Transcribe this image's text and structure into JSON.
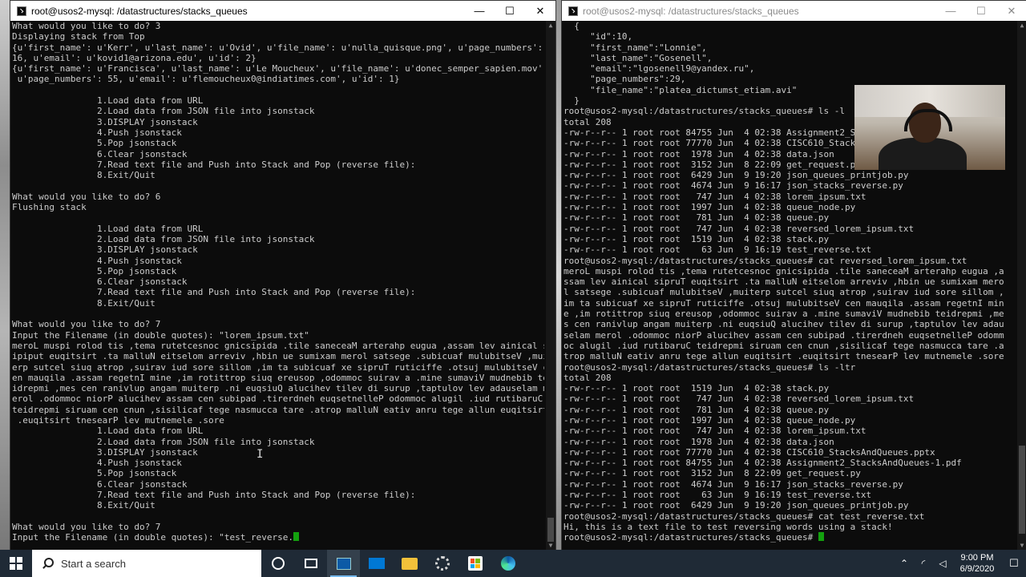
{
  "left_window": {
    "title": "root@usos2-mysql: /datastructures/stacks_queues",
    "controls": [
      "—",
      "☐",
      "✕"
    ],
    "lines": [
      "What would you like to do? 3",
      "Displaying stack from Top",
      "{u'first_name': u'Kerr', u'last_name': u'Ovid', u'file_name': u'nulla_quisque.png', u'page_numbers':",
      "16, u'email': u'kovid1@arizona.edu', u'id': 2}",
      "{u'first_name': u'Francisca', u'last_name': u'Le Moucheux', u'file_name': u'donec_semper_sapien.mov',",
      " u'page_numbers': 55, u'email': u'flemoucheux0@indiatimes.com', u'id': 1}",
      "",
      "                1.Load data from URL",
      "                2.Load data from JSON file into jsonstack",
      "                3.DISPLAY jsonstack",
      "                4.Push jsonstack",
      "                5.Pop jsonstack",
      "                6.Clear jsonstack",
      "                7.Read text file and Push into Stack and Pop (reverse file):",
      "                8.Exit/Quit",
      "",
      "What would you like to do? 6",
      "Flushing stack",
      "",
      "                1.Load data from URL",
      "                2.Load data from JSON file into jsonstack",
      "                3.DISPLAY jsonstack",
      "                4.Push jsonstack",
      "                5.Pop jsonstack",
      "                6.Clear jsonstack",
      "                7.Read text file and Push into Stack and Pop (reverse file):",
      "                8.Exit/Quit",
      "",
      "What would you like to do? 7",
      "Input the Filename (in double quotes): \"lorem_ipsum.txt\"",
      "meroL muspi rolod tis ,tema rutetcesnoc gnicsipida .tile saneceaM arterahp eugua ,assam lev ainical s",
      "ipiput euqitsirt .ta malluN eitselom arreviv ,hbin ue sumixam merol satsege .subicuaf mulubitseV ,muit",
      "erp sutcel siuq atrop ,suirav iud sore sillom ,im ta subicuaf xe sipruT ruticiffe .otsuj mulubitseV c",
      "en mauqila .assam regetnI mine ,im rotittrop siuq ereusop ,odommoc suirav a .mine sumaviV mudnebib te",
      "idrepmi ,mes cen ranivlup angam muiterp .ni euqsiuQ alucihev tilev di surup ,taptulov lev adauselam m",
      "erol .odommoc niorP alucihev assam cen subipad .tirerdneh euqsetnelleP odommoc alugil .iud rutibaruC",
      "teidrepmi siruam cen cnun ,sisilicaf tege nasmucca tare .atrop malluN eativ anru tege allun euqitsirt",
      " .euqitsirt tnesearP lev mutnemele .sore",
      "                1.Load data from URL",
      "                2.Load data from JSON file into jsonstack",
      "                3.DISPLAY jsonstack",
      "                4.Push jsonstack",
      "                5.Pop jsonstack",
      "                6.Clear jsonstack",
      "                7.Read text file and Push into Stack and Pop (reverse file):",
      "                8.Exit/Quit",
      "",
      "What would you like to do? 7"
    ],
    "prompt_line": "Input the Filename (in double quotes): \"test_reverse."
  },
  "right_window": {
    "title": "root@usos2-mysql: /datastructures/stacks_queues",
    "controls": [
      "—",
      "☐",
      "✕"
    ],
    "lines": [
      "  {",
      "     \"id\":10,",
      "     \"first_name\":\"Lonnie\",",
      "     \"last_name\":\"Gosenell\",",
      "     \"email\":\"lgosenell9@yandex.ru\",",
      "     \"page_numbers\":29,",
      "     \"file_name\":\"platea_dictumst_etiam.avi\"",
      "  }",
      "root@usos2-mysql:/datastructures/stacks_queues# ls -l",
      "total 208",
      "-rw-r--r-- 1 root root 84755 Jun  4 02:38 Assignment2_S",
      "-rw-r--r-- 1 root root 77770 Jun  4 02:38 CISC610_Stack",
      "-rw-r--r-- 1 root root  1978 Jun  4 02:38 data.json",
      "-rw-r--r-- 1 root root  3152 Jun  8 22:09 get_request.p",
      "-rw-r--r-- 1 root root  6429 Jun  9 19:20 json_queues_printjob.py",
      "-rw-r--r-- 1 root root  4674 Jun  9 16:17 json_stacks_reverse.py",
      "-rw-r--r-- 1 root root   747 Jun  4 02:38 lorem_ipsum.txt",
      "-rw-r--r-- 1 root root  1997 Jun  4 02:38 queue_node.py",
      "-rw-r--r-- 1 root root   781 Jun  4 02:38 queue.py",
      "-rw-r--r-- 1 root root   747 Jun  4 02:38 reversed_lorem_ipsum.txt",
      "-rw-r--r-- 1 root root  1519 Jun  4 02:38 stack.py",
      "-rw-r--r-- 1 root root    63 Jun  9 16:19 test_reverse.txt",
      "root@usos2-mysql:/datastructures/stacks_queues# cat reversed_lorem_ipsum.txt",
      "meroL muspi rolod tis ,tema rutetcesnoc gnicsipida .tile saneceaM arterahp eugua ,a",
      "ssam lev ainical sipruT euqitsirt .ta malluN eitselom arreviv ,hbin ue sumixam mero",
      "l satsege .subicuaf mulubitseV ,muiterp sutcel siuq atrop ,suirav iud sore sillom ,",
      "im ta subicuaf xe sipruT ruticiffe .otsuj mulubitseV cen mauqila .assam regetnI min",
      "e ,im rotittrop siuq ereusop ,odommoc suirav a .mine sumaviV mudnebib teidrepmi ,me",
      "s cen ranivlup angam muiterp .ni euqsiuQ alucihev tilev di surup ,taptulov lev adau",
      "selam merol .odommoc niorP alucihev assam cen subipad .tirerdneh euqsetnelleP odomm",
      "oc alugil .iud rutibaruC teidrepmi siruam cen cnun ,sisilicaf tege nasmucca tare .a",
      "trop malluN eativ anru tege allun euqitsirt .euqitsirt tnesearP lev mutnemele .sore",
      "root@usos2-mysql:/datastructures/stacks_queues# ls -ltr",
      "total 208",
      "-rw-r--r-- 1 root root  1519 Jun  4 02:38 stack.py",
      "-rw-r--r-- 1 root root   747 Jun  4 02:38 reversed_lorem_ipsum.txt",
      "-rw-r--r-- 1 root root   781 Jun  4 02:38 queue.py",
      "-rw-r--r-- 1 root root  1997 Jun  4 02:38 queue_node.py",
      "-rw-r--r-- 1 root root   747 Jun  4 02:38 lorem_ipsum.txt",
      "-rw-r--r-- 1 root root  1978 Jun  4 02:38 data.json",
      "-rw-r--r-- 1 root root 77770 Jun  4 02:38 CISC610_StacksAndQueues.pptx",
      "-rw-r--r-- 1 root root 84755 Jun  4 02:38 Assignment2_StacksAndQueues-1.pdf",
      "-rw-r--r-- 1 root root  3152 Jun  8 22:09 get_request.py",
      "-rw-r--r-- 1 root root  4674 Jun  9 16:17 json_stacks_reverse.py",
      "-rw-r--r-- 1 root root    63 Jun  9 16:19 test_reverse.txt",
      "-rw-r--r-- 1 root root  6429 Jun  9 19:20 json_queues_printjob.py",
      "root@usos2-mysql:/datastructures/stacks_queues# cat test_reverse.txt",
      "Hi, this is a text file to test reversing words using a stack!"
    ],
    "prompt_line": "root@usos2-mysql:/datastructures/stacks_queues# "
  },
  "taskbar": {
    "search_placeholder": "Start a search",
    "time": "9:00 PM",
    "date": "6/9/2020",
    "tray_icons": [
      "chevron-up-icon",
      "network-icon",
      "volume-icon"
    ]
  },
  "colors": {
    "terminal_bg": "#0c0c0c",
    "terminal_text": "#cccccc",
    "cursor": "#13a10e",
    "taskbar_bg": "#1f2a36",
    "accent": "#76b9ed"
  }
}
